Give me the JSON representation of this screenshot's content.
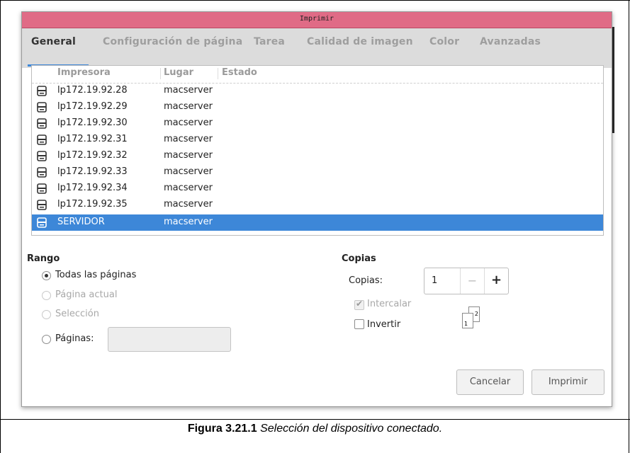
{
  "window": {
    "title": "Imprimir"
  },
  "tabs": [
    {
      "label": "General"
    },
    {
      "label": "Configuración de página"
    },
    {
      "label": "Tarea"
    },
    {
      "label": "Calidad de imagen"
    },
    {
      "label": "Color"
    },
    {
      "label": "Avanzadas"
    }
  ],
  "printer_list": {
    "columns": [
      "Impresora",
      "Lugar",
      "Estado"
    ],
    "rows": [
      {
        "name": "lp172.19.92.28",
        "place": "macserver"
      },
      {
        "name": "lp172.19.92.29",
        "place": "macserver"
      },
      {
        "name": "lp172.19.92.30",
        "place": "macserver"
      },
      {
        "name": "lp172.19.92.31",
        "place": "macserver"
      },
      {
        "name": "lp172.19.92.32",
        "place": "macserver"
      },
      {
        "name": "lp172.19.92.33",
        "place": "macserver"
      },
      {
        "name": "lp172.19.92.34",
        "place": "macserver"
      },
      {
        "name": "lp172.19.92.35",
        "place": "macserver"
      },
      {
        "name": "SERVIDOR",
        "place": "macserver",
        "selected": true
      }
    ]
  },
  "range": {
    "title": "Rango",
    "options": [
      {
        "label": "Todas las páginas",
        "checked": true,
        "disabled": false
      },
      {
        "label": "Página actual",
        "checked": false,
        "disabled": true
      },
      {
        "label": "Selección",
        "checked": false,
        "disabled": true
      },
      {
        "label": "Páginas:",
        "checked": false,
        "disabled": false
      }
    ],
    "pages_value": ""
  },
  "copies": {
    "title": "Copias",
    "label": "Copias:",
    "value": "1",
    "minus": "−",
    "plus": "+",
    "collate_label": "Intercalar",
    "collate_checked": true,
    "collate_disabled": true,
    "reverse_label": "Invertir",
    "reverse_checked": false,
    "collate_pages": [
      "1",
      "2"
    ]
  },
  "buttons": {
    "cancel": "Cancelar",
    "print": "Imprimir"
  },
  "caption": {
    "label": "Figura 3.21.1",
    "text": " Selección del dispositivo conectado."
  },
  "colors": {
    "accent": "#3d87d8",
    "titlebar": "#e06b86"
  }
}
